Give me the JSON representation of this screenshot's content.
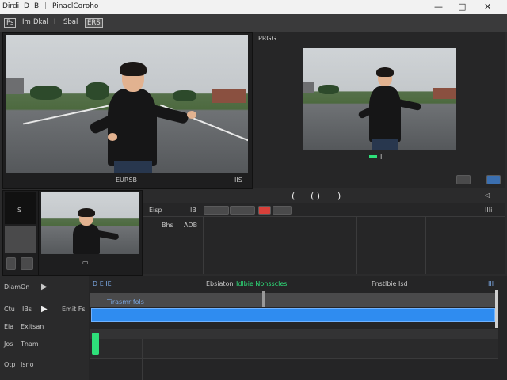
{
  "window": {
    "menu_icons": [
      "Dirdi",
      "D",
      "B"
    ],
    "title": "PinaclCoroho",
    "controls": [
      "—",
      "□",
      "✕"
    ]
  },
  "menubar": {
    "items": [
      "Ps",
      "Im",
      "Dkal",
      "I",
      "Sbal",
      "ERS"
    ]
  },
  "preview_left": {
    "caption": "EURSB",
    "corner": "IIS"
  },
  "preview_right": {
    "label": "PRGG",
    "caption": "I"
  },
  "transport": {
    "left": "(",
    "mid": "( )",
    "right": ")"
  },
  "clip_browser": {
    "top_label": "S",
    "thumb_icon": "film-icon",
    "mini_label": "LI"
  },
  "effects_bar": {
    "label1": "Eisp",
    "label2": "IB",
    "sub1": "Bhs",
    "sub2": "ADB",
    "right": "IIIi"
  },
  "timeline": {
    "header_left": "D E IE",
    "header_mid": "Ebsiaton",
    "header_green": "Idlbie Nonsscles",
    "header_right": "Fnstlbie Isd",
    "header_far": "III",
    "clip_label": "Tirasmr fols",
    "tracks": [
      {
        "name": "Diam",
        "value": "On",
        "icon": "play-icon"
      },
      {
        "name": "Ctu",
        "value": "IBs",
        "icon": "play-icon",
        "extra": "Emit Fs"
      },
      {
        "name": "Eia",
        "value": "Exitsan"
      },
      {
        "name": "Jos",
        "value": "Tnam"
      },
      {
        "name": "Otp",
        "value": "Isno"
      }
    ]
  },
  "colors": {
    "accent": "#2f8cf0",
    "green": "#2ee07a",
    "red": "#d8403a"
  }
}
